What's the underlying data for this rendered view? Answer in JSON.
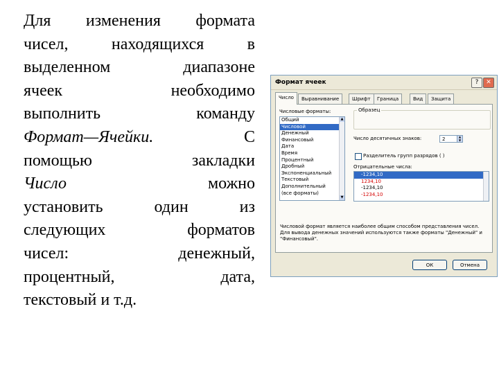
{
  "slide_text": {
    "l1": [
      "Для",
      "изменения",
      "формата"
    ],
    "l2": [
      "чисел,",
      "находящихся",
      "в"
    ],
    "l3": [
      "выделенном",
      "диапазоне"
    ],
    "l4": [
      "ячеек",
      "необходимо"
    ],
    "l5": [
      "выполнить",
      "команду"
    ],
    "l6_cmd": "Формат—Ячейки.",
    "l6_c": "С",
    "l7": [
      "помощью",
      "закладки"
    ],
    "l8_tab": "Число",
    "l8_w": "можно",
    "l9": [
      "установить",
      "один",
      "из"
    ],
    "l10": [
      "следующих",
      "форматов"
    ],
    "l11": [
      "чисел:",
      "денежный,"
    ],
    "l12": [
      "процентный,",
      "дата,"
    ],
    "l13": "текстовый и т.д."
  },
  "dialog": {
    "title": "Формат ячеек",
    "help": "?",
    "close": "✕",
    "tabs": [
      "Число",
      "Выравнивание",
      "Шрифт",
      "Граница",
      "Вид",
      "Защита"
    ],
    "formats_label": "Числовые форматы:",
    "formats": [
      "Общий",
      "Числовой",
      "Денежный",
      "Финансовый",
      "Дата",
      "Время",
      "Процентный",
      "Дробный",
      "Экспоненциальный",
      "Текстовый",
      "Дополнительный",
      "(все форматы)"
    ],
    "selected_format": "Числовой",
    "sample_label": "Образец",
    "decimals_label": "Число десятичных знаков:",
    "decimals_value": "2",
    "separator_label": "Разделитель групп разрядов ( )",
    "negative_label": "Отрицательные числа:",
    "negatives": [
      "-1234,10",
      "1234,10",
      "-1234,10",
      "-1234,10"
    ],
    "description": "Числовой формат является наиболее общим способом представления чисел. Для вывода денежных значений используются также форматы \"Денежный\" и \"Финансовый\".",
    "ok": "ОК",
    "cancel": "Отмена"
  }
}
